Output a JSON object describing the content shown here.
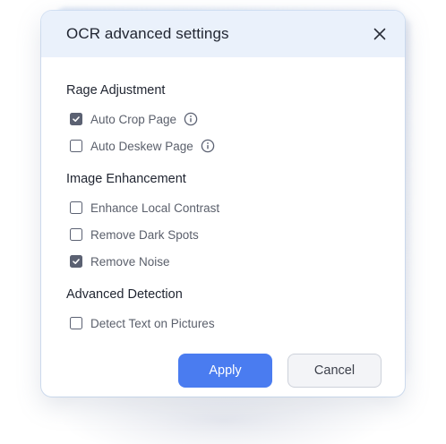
{
  "dialog": {
    "title": "OCR advanced settings",
    "close_icon": "close-icon"
  },
  "sections": [
    {
      "title": "Rage Adjustment",
      "options": [
        {
          "label": "Auto Crop Page",
          "checked": true,
          "info": true
        },
        {
          "label": "Auto Deskew Page",
          "checked": false,
          "info": true
        }
      ]
    },
    {
      "title": "Image Enhancement",
      "options": [
        {
          "label": "Enhance Local Contrast",
          "checked": false,
          "info": false
        },
        {
          "label": "Remove Dark Spots",
          "checked": false,
          "info": false
        },
        {
          "label": "Remove Noise",
          "checked": true,
          "info": false
        }
      ]
    },
    {
      "title": "Advanced Detection",
      "options": [
        {
          "label": "Detect Text on Pictures",
          "checked": false,
          "info": false
        }
      ]
    }
  ],
  "buttons": {
    "apply_label": "Apply",
    "cancel_label": "Cancel"
  },
  "colors": {
    "header_bg": "#eaf1fb",
    "accent": "#4a7cf0",
    "checkbox": "#5b6172"
  }
}
